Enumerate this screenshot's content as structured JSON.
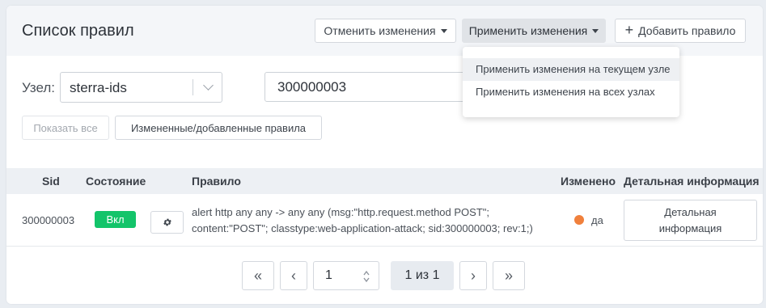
{
  "header": {
    "title": "Список правил",
    "revert_label": "Отменить изменения",
    "apply_label": "Применить изменения",
    "add_label": "Добавить правило"
  },
  "apply_menu": {
    "items": [
      {
        "label": "Применить изменения на текущем узле",
        "active": true
      },
      {
        "label": "Применить изменения на всех узлах",
        "active": false
      }
    ]
  },
  "filters": {
    "node_label": "Узел:",
    "node_value": "sterra-ids",
    "search_value": "300000003",
    "show_all_label": "Показать все",
    "modified_label": "Измененные/добавленные правила"
  },
  "table": {
    "columns": {
      "sid": "Sid",
      "state": "Состояние",
      "rule": "Правило",
      "changed": "Изменено",
      "details": "Детальная информация"
    },
    "rows": [
      {
        "sid": "300000003",
        "state": "Вкл",
        "rule": "alert http any any -> any any (msg:\"http.request.method POST\"; content:\"POST\"; classtype:web-application-attack; sid:300000003; rev:1;)",
        "changed": "да",
        "details_label": "Детальная информация"
      }
    ]
  },
  "pagination": {
    "current_page": "1",
    "info": "1 из 1",
    "first": "«",
    "prev": "‹",
    "next": "›",
    "last": "»"
  },
  "colors": {
    "badge_on": "#13c46a",
    "changed_dot": "#f0803c"
  }
}
